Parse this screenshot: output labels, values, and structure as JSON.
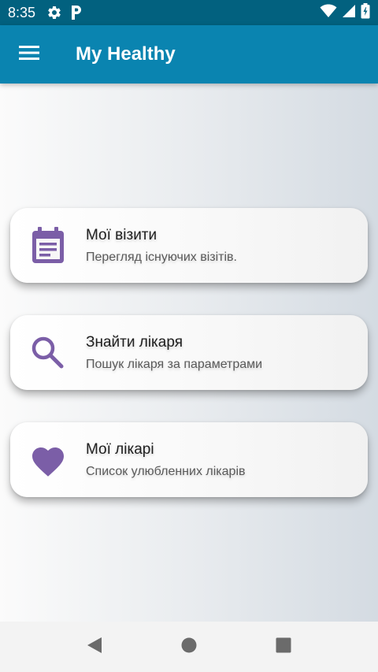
{
  "status_bar": {
    "time": "8:35",
    "icons": [
      "gear-icon",
      "parking-icon",
      "wifi-icon",
      "signal-icon",
      "battery-icon"
    ]
  },
  "app_bar": {
    "title": "My Healthy",
    "menu_icon": "hamburger-menu-icon"
  },
  "menu": {
    "items": [
      {
        "title": "Мої візити",
        "subtitle": "Перегляд існуючих візітів.",
        "icon": "calendar-icon"
      },
      {
        "title": "Знайти лікаря",
        "subtitle": "Пошук лікаря за параметрами",
        "icon": "search-icon"
      },
      {
        "title": "Мої лікарі",
        "subtitle": "Список улюбленних лікарів",
        "icon": "heart-icon"
      }
    ]
  },
  "nav_bar": {
    "buttons": [
      "back-icon",
      "home-icon",
      "recents-icon"
    ]
  },
  "colors": {
    "status_bar": "#02617f",
    "app_bar": "#0a84b0",
    "icon_accent": "#7b5ea7"
  }
}
